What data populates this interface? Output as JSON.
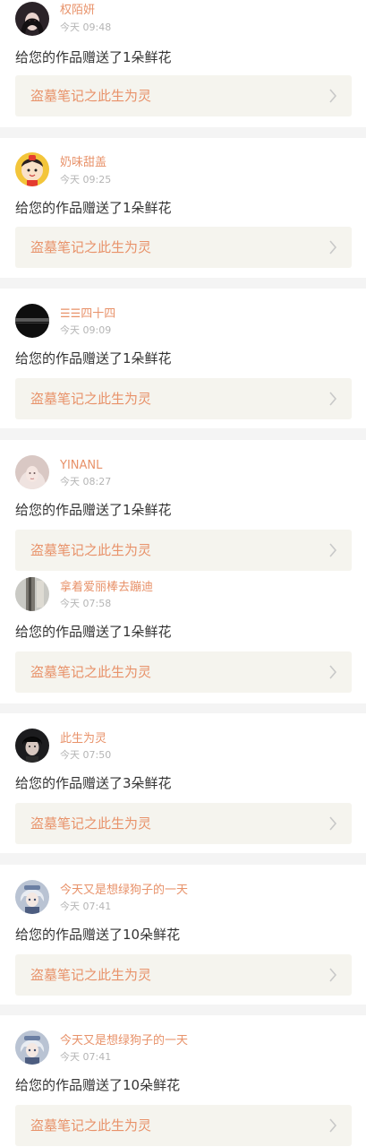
{
  "colors": {
    "accent": "#e8926a",
    "card_bg": "#ffffff",
    "page_bg": "#f4f4f4",
    "work_bg": "#f5f4ee",
    "time": "#b5b5b5",
    "text": "#333333"
  },
  "notifications": [
    {
      "user": "权陌妍",
      "time": "今天 09:48",
      "message": "给您的作品赠送了1朵鲜花",
      "work": "盗墓笔记之此生为灵",
      "avatar_icon": "avatar-dark-hair-icon"
    },
    {
      "user": "奶味甜盖",
      "time": "今天 09:25",
      "message": "给您的作品赠送了1朵鲜花",
      "work": "盗墓笔记之此生为灵",
      "avatar_icon": "avatar-cartoon-icon"
    },
    {
      "user": "☰☰四十四",
      "time": "今天 09:09",
      "message": "给您的作品赠送了1朵鲜花",
      "work": "盗墓笔记之此生为灵",
      "avatar_icon": "avatar-dark-stripe-icon"
    },
    {
      "user": "YINANL",
      "time": "今天 08:27",
      "message": "给您的作品赠送了1朵鲜花",
      "work": "盗墓笔记之此生为灵",
      "avatar_icon": "avatar-pale-hair-icon"
    },
    {
      "user": "拿着爱丽棒去蹦迪",
      "time": "今天 07:58",
      "message": "给您的作品赠送了1朵鲜花",
      "work": "盗墓笔记之此生为灵",
      "avatar_icon": "avatar-gray-photo-icon"
    },
    {
      "user": "此生为灵",
      "time": "今天 07:50",
      "message": "给您的作品赠送了3朵鲜花",
      "work": "盗墓笔记之此生为灵",
      "avatar_icon": "avatar-dark-portrait-icon"
    },
    {
      "user": "今天又是想绿狗子的一天",
      "time": "今天 07:41",
      "message": "给您的作品赠送了10朵鲜花",
      "work": "盗墓笔记之此生为灵",
      "avatar_icon": "avatar-anime-icon"
    },
    {
      "user": "今天又是想绿狗子的一天",
      "time": "今天 07:41",
      "message": "给您的作品赠送了10朵鲜花",
      "work": "盗墓笔记之此生为灵",
      "avatar_icon": "avatar-anime-icon"
    }
  ]
}
